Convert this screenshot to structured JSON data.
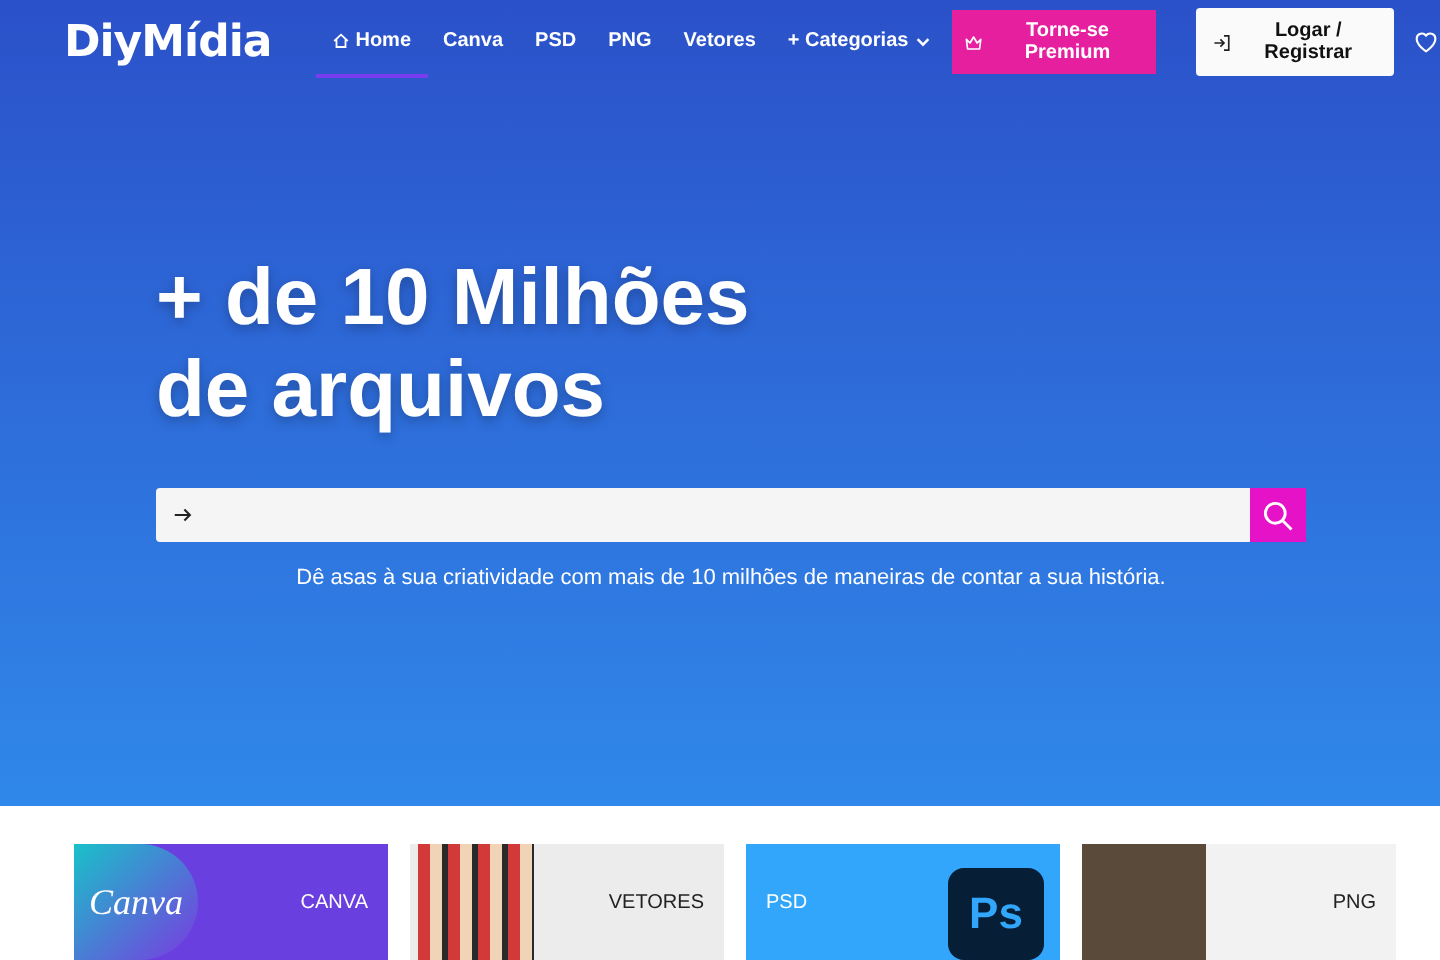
{
  "header": {
    "logo": "DiyMídia",
    "nav": [
      {
        "label": "Home",
        "selected": true,
        "kind": "home"
      },
      {
        "label": "Canva",
        "selected": false,
        "kind": "link"
      },
      {
        "label": "PSD",
        "selected": false,
        "kind": "link"
      },
      {
        "label": "PNG",
        "selected": false,
        "kind": "link"
      },
      {
        "label": "Vetores",
        "selected": false,
        "kind": "link"
      },
      {
        "label": "+ Categorias",
        "selected": false,
        "kind": "dropdown"
      }
    ],
    "premium_button": "Torne-se Premium",
    "login_button": "Logar / Registrar"
  },
  "hero": {
    "heading_lines": [
      "+ de 10 Milhões",
      "de arquivos"
    ],
    "tagline": "Dê asas à sua criatividade com mais de 10 milhões de maneiras de contar a sua história."
  },
  "categories": [
    {
      "kind": "canva",
      "logo": "Canva",
      "label": "CANVA"
    },
    {
      "kind": "vetores",
      "label": "VETORES"
    },
    {
      "kind": "psd",
      "logo": "Ps",
      "label": "PSD"
    },
    {
      "kind": "png",
      "label": "PNG"
    }
  ]
}
